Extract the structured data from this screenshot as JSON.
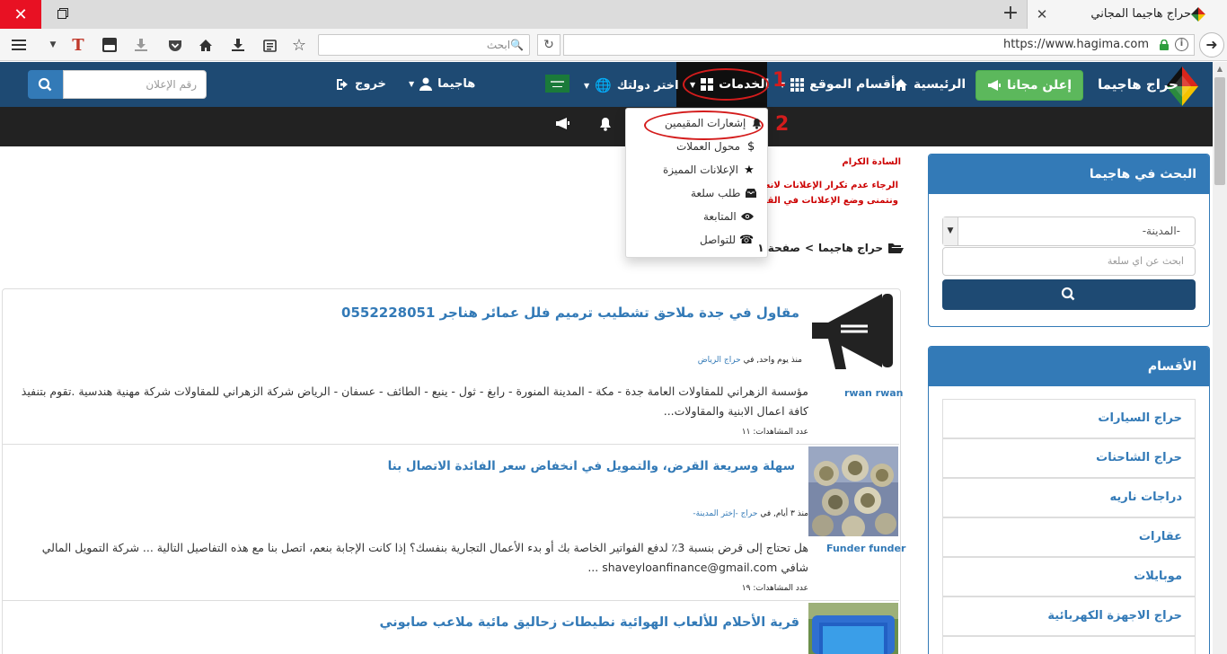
{
  "browser": {
    "tab_title": "حراج هاجيما المجاني",
    "url": "https://www.hagima.com",
    "search_placeholder": "ابحث",
    "new_tab": "+",
    "close_symbol": "✕"
  },
  "nav": {
    "logo_text": "حراج هاجيما",
    "post_button": "إعلن مجانا",
    "home": "الرئيسية",
    "sections": "أقسام الموقع",
    "services": "الخدمات",
    "choose_country": "اختر دولتك",
    "user": "هاجيما",
    "logout": "خروج",
    "ad_number_placeholder": "رقم الإعلان"
  },
  "dropdown": {
    "items": [
      {
        "label": "إشعارات المقيمين",
        "icon": "bell-icon"
      },
      {
        "label": "محول العملات",
        "icon": "dollar-icon"
      },
      {
        "label": "الإعلانات المميزة",
        "icon": "star-icon"
      },
      {
        "label": "طلب سلعة",
        "icon": "inbox-icon"
      },
      {
        "label": "المتابعة",
        "icon": "eye-icon"
      },
      {
        "label": "للتواصل",
        "icon": "phone-icon"
      }
    ]
  },
  "annotations": {
    "one": "1",
    "two": "2"
  },
  "notice": {
    "line1": "السادة الكرام",
    "line2": "الرجاء عدم تكرار الإعلانات لانه سيتم",
    "line3": "ونتمنى وضع الإعلانات في القسم المن"
  },
  "breadcrumb": {
    "root": "حراج هاجيما",
    "sep": ">",
    "page": "صفحة ١"
  },
  "sidebar": {
    "search_title": "البحث في هاجيما",
    "city_select": "-المدينة-",
    "item_search_placeholder": "ابحث عن اي سلعة",
    "categories_title": "الأقسام",
    "categories": [
      "حراج السيارات",
      "حراج الشاحنات",
      "دراجات ناريه",
      "عقارات",
      "موبايلات",
      "حراج الاجهزة الكهربائية"
    ]
  },
  "listings": [
    {
      "title": "مقاول في جدة ملاحق تشطيب ترميم فلل عمائر هناجر 0552228051",
      "meta_prefix": "منذ يوم واحد, في",
      "meta_link": "حراج الرياض",
      "desc_line1": "مؤسسة الزهراني للمقاولات العامة جدة - مكة - المدينة المنورة - رابغ - ثول - ينبع - الطائف - عسفان - الرياض شركة الزهراني للمقاولات شركة مهنية هندسية .تقوم بتنفيذ",
      "desc_line2": "كافة اعمال الابنية والمقاولات...",
      "views": "عدد المشاهدات: ١١",
      "user": "rwan rwan"
    },
    {
      "title": "سهلة وسريعة القرض، والتمويل في انخفاض سعر الفائدة الاتصال بنا",
      "meta_prefix": "منذ ٣ أيام, في",
      "meta_link": "حراج -إختر المدينة-",
      "desc_line1": "هل تحتاج إلى قرض بنسبة 3٪ لدفع الفواتير الخاصة بك أو بدء الأعمال التجارية بنفسك؟ إذا كانت الإجابة بنعم، اتصل بنا مع هذه التفاصيل التالية ... شركة التمويل المالي",
      "desc_line2": "شافي shaveyloanfinance@gmail.com ...",
      "views": "عدد المشاهدات: ١٩",
      "user": "Funder funder"
    },
    {
      "title": "قرية الأحلام للألعاب الهوائية نطيطات زحاليق مائية ملاعب صابوني"
    }
  ]
}
